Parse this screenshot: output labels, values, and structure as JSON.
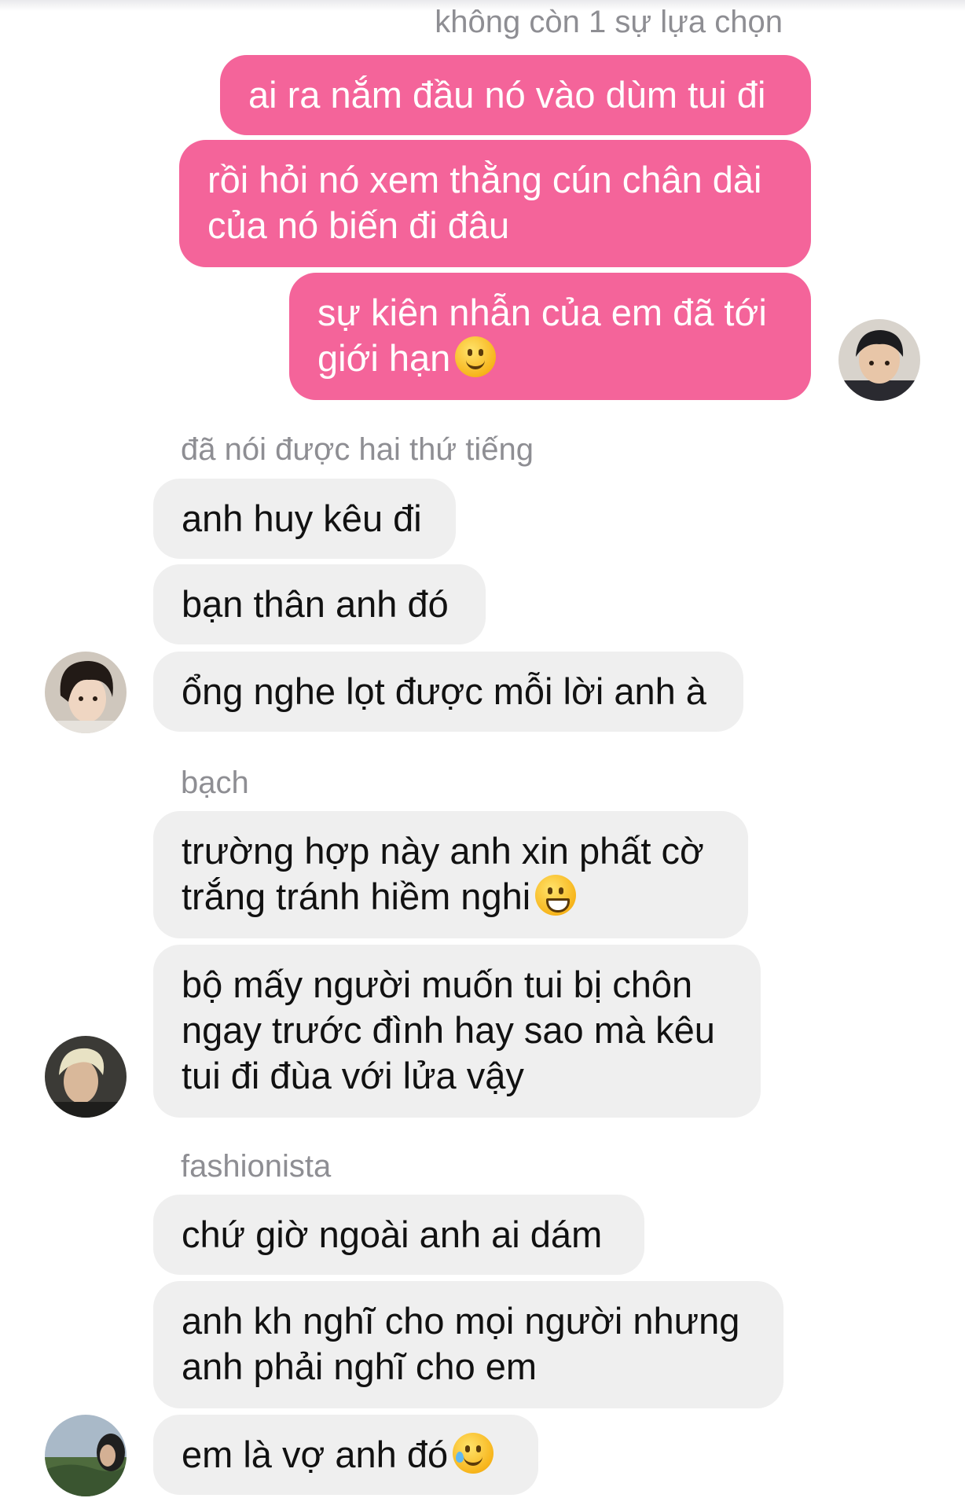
{
  "chat": {
    "groups": [
      {
        "sender": "không còn 1 sự lựa chọn",
        "side": "out",
        "messages": [
          {
            "line1": "ai ra nắm đầu nó vào dùm tui đi"
          },
          {
            "line1": "rồi hỏi nó xem thằng cún chân dài",
            "line2": "của nó biến đi đâu"
          },
          {
            "line1": "sự kiên nhẫn của em đã tới",
            "line2": "giới hạn",
            "emoji": "slightly-smiling-face-icon"
          }
        ]
      },
      {
        "sender": "đã nói được hai thứ tiếng",
        "side": "in",
        "messages": [
          {
            "line1": "anh huy kêu đi"
          },
          {
            "line1": "bạn thân anh đó"
          },
          {
            "line1": "ổng nghe lọt được mỗi lời anh à"
          }
        ]
      },
      {
        "sender": "bạch",
        "side": "in",
        "messages": [
          {
            "line1": "trường hợp này anh xin phất cờ",
            "line2": "trắng tránh hiềm nghi",
            "emoji": "grinning-face-icon"
          },
          {
            "line1": "bộ mấy người muốn tui bị chôn",
            "line2": "ngay trước đình hay sao mà kêu",
            "line3": "tui đi đùa với lửa vậy"
          }
        ]
      },
      {
        "sender": "fashionista",
        "side": "in",
        "messages": [
          {
            "line1": "chứ giờ ngoài anh ai dám"
          },
          {
            "line1": "anh kh nghĩ cho mọi người nhưng",
            "line2": "anh phải nghĩ cho em"
          },
          {
            "line1": "em là vợ anh đó",
            "emoji": "sad-but-relieved-face-icon"
          }
        ]
      }
    ],
    "colors": {
      "outgoing_bubble": "#f4649a",
      "incoming_bubble": "#efefef",
      "sender_name": "#8e8e93"
    }
  }
}
